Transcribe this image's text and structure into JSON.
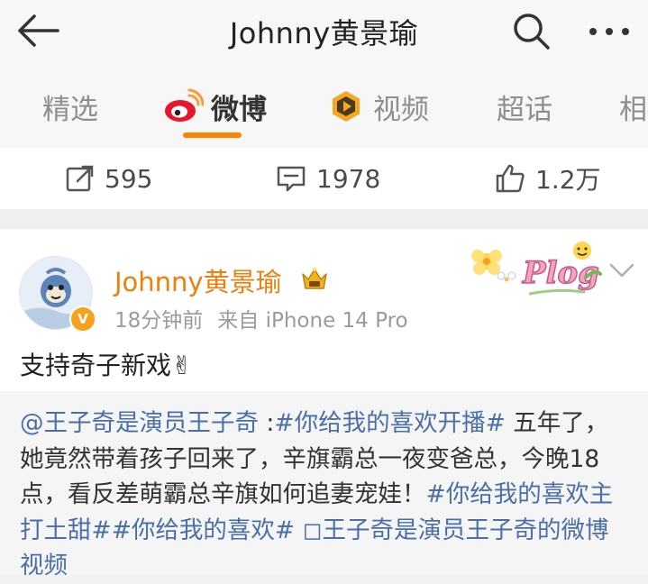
{
  "header": {
    "title": "Johnny黄景瑜",
    "back_icon": "arrow-left-icon",
    "search_icon": "search-icon",
    "more_icon": "more-horizontal-icon"
  },
  "tabs": [
    {
      "label": "精选",
      "icon": null,
      "active": false
    },
    {
      "label": "微博",
      "icon": "weibo-icon",
      "active": true
    },
    {
      "label": "视频",
      "icon": "video-icon",
      "active": false
    },
    {
      "label": "超话",
      "icon": null,
      "active": false
    },
    {
      "label": "相",
      "icon": null,
      "active": false
    }
  ],
  "actions": {
    "repost": "595",
    "comment": "1978",
    "like": "1.2万"
  },
  "post": {
    "author": "Johnny黄景瑜",
    "time": "18分钟前",
    "source": "来自 iPhone 14 Pro",
    "text": "支持奇子新戏✌",
    "sticker_text": "Plog",
    "verified_badge": "V"
  },
  "repost": {
    "mention": "@王子奇是演员王子奇",
    "sep": " :",
    "topic1": "#你给我的喜欢开播#",
    "body": " 五年了，她竟然带着孩子回来了，辛旗霸总一夜变爸总，今晚18点，看反差萌霸总辛旗如何追妻宠娃！",
    "topic2": "#你给我的喜欢主打土甜#",
    "topic3": "#你给我的喜欢#",
    "video_link": " ◻王子奇是演员王子奇的微博视频"
  },
  "colors": {
    "accent": "#ff8200",
    "author": "#f07e0a",
    "link": "#4a6fa8"
  }
}
